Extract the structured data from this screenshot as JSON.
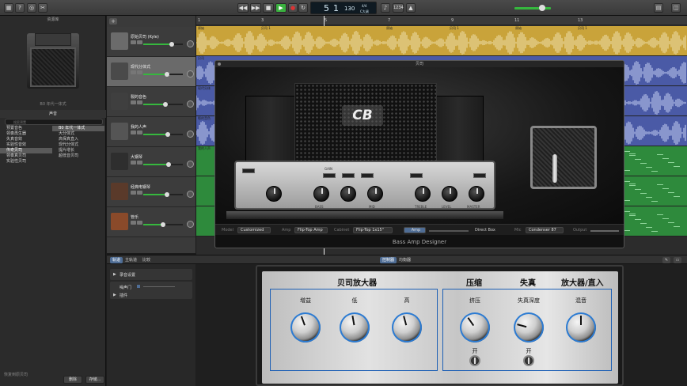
{
  "toolbar": {
    "lcd": {
      "bar": "5",
      "beat": "1",
      "tempo": "130",
      "sig_top": "4/4",
      "sig_key": "C大调"
    },
    "count_in": "1234",
    "colors": {
      "play": "#3ab03f",
      "record": "#d33",
      "accent": "#4f6d95"
    }
  },
  "library": {
    "preset_caption": "B0 年代一体式",
    "section_title": "声音",
    "search_placeholder": "搜索预置",
    "categories": [
      "预置音色",
      "领奏再生器",
      "失真音效",
      "实验性音效",
      "传奇贝司",
      "领奏真贝司",
      "实验性贝司"
    ],
    "selected_category": 4,
    "presets": [
      "B0 年代一体式",
      "大分体式",
      "高保真直入",
      "现代分体式",
      "提片增长",
      "超低音贝司"
    ],
    "selected_preset": 0,
    "footer_hint": "恢复到原贝司",
    "delete": "删除",
    "save": "存储..."
  },
  "tracks": [
    {
      "name": "原始贝司 (Kyle)"
    },
    {
      "name": "现代分体式"
    },
    {
      "name": "裂的音色"
    },
    {
      "name": "我的人声"
    },
    {
      "name": "大钢琴"
    },
    {
      "name": "经典电钢琴"
    },
    {
      "name": "管乐"
    }
  ],
  "timeline": {
    "ruler": [
      "1",
      "3",
      "5",
      "7",
      "9",
      "11",
      "13"
    ],
    "region_labels": [
      "原始",
      "贝司 1",
      "原始",
      "贝司 1",
      "原始",
      "贝司 1",
      "贝司",
      "现代分体",
      "裂的音色",
      "我的人声"
    ]
  },
  "plugin": {
    "title": "贝司",
    "name": "Bass Amp Designer",
    "logo": "CB",
    "controls": {
      "model_label": "Model",
      "model": "Customized",
      "amp_label": "Amp",
      "amp": "Flip-Top Amp",
      "cabinet_label": "Cabinet",
      "cabinet": "Flip-Top 1x15\"",
      "amp_btn": "Amp",
      "direct_label": "Direct Box",
      "mic_label": "Mic",
      "mic": "Condenser 87",
      "output_label": "Output"
    },
    "amp_labels": [
      "GAIN",
      "BASS",
      "MID",
      "TREBLE",
      "LEVEL",
      "MASTER"
    ]
  },
  "editor": {
    "tabs": [
      "轨道",
      "主轨道",
      "比较"
    ],
    "smart_tabs": [
      "控制器",
      "均衡器"
    ],
    "sections": [
      "录音设置",
      "插件"
    ],
    "noise_gate": "噪声门"
  },
  "smart_controls": {
    "groups": [
      {
        "title": "贝司放大器",
        "knobs": [
          "增益",
          "低",
          "高"
        ],
        "angles": [
          -20,
          -10,
          -15
        ]
      },
      {
        "title": "压缩",
        "knobs": [
          "挤压"
        ],
        "angles": [
          -35
        ],
        "toggle": "开"
      },
      {
        "title": "失真",
        "knobs": [
          "失真深度"
        ],
        "angles": [
          -75
        ],
        "toggle": "开"
      },
      {
        "title": "放大器/直入",
        "knobs": [
          "混音"
        ],
        "angles": [
          0
        ]
      }
    ]
  }
}
